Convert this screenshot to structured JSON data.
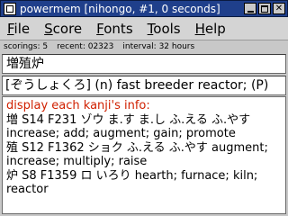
{
  "window": {
    "title": "powermem [nihongo, #1, 0 seconds]"
  },
  "menu": {
    "items": [
      {
        "first": "F",
        "rest": "ile"
      },
      {
        "first": "S",
        "rest": "core"
      },
      {
        "first": "F",
        "rest": "onts"
      },
      {
        "first": "T",
        "rest": "ools"
      },
      {
        "first": "H",
        "rest": "elp"
      }
    ]
  },
  "status": {
    "scorings": "scorings: 5",
    "recent": "recent: 02323",
    "interval": "interval: 32 hours"
  },
  "card": {
    "word": "増殖炉",
    "reading": "[ぞうしょくろ] (n) fast breeder reactor; (P)"
  },
  "info": {
    "heading": "display each kanji's info:",
    "lines": [
      "増 S14 F231 ゾウ ま.す ま.し ふ.える ふ.やす increase; add; augment; gain; promote",
      "殖 S12 F1362 ショク ふ.える ふ.やす augment; increase; multiply; raise",
      "炉 S8 F1359 ロ いろり hearth; furnace; kiln; reactor"
    ]
  }
}
